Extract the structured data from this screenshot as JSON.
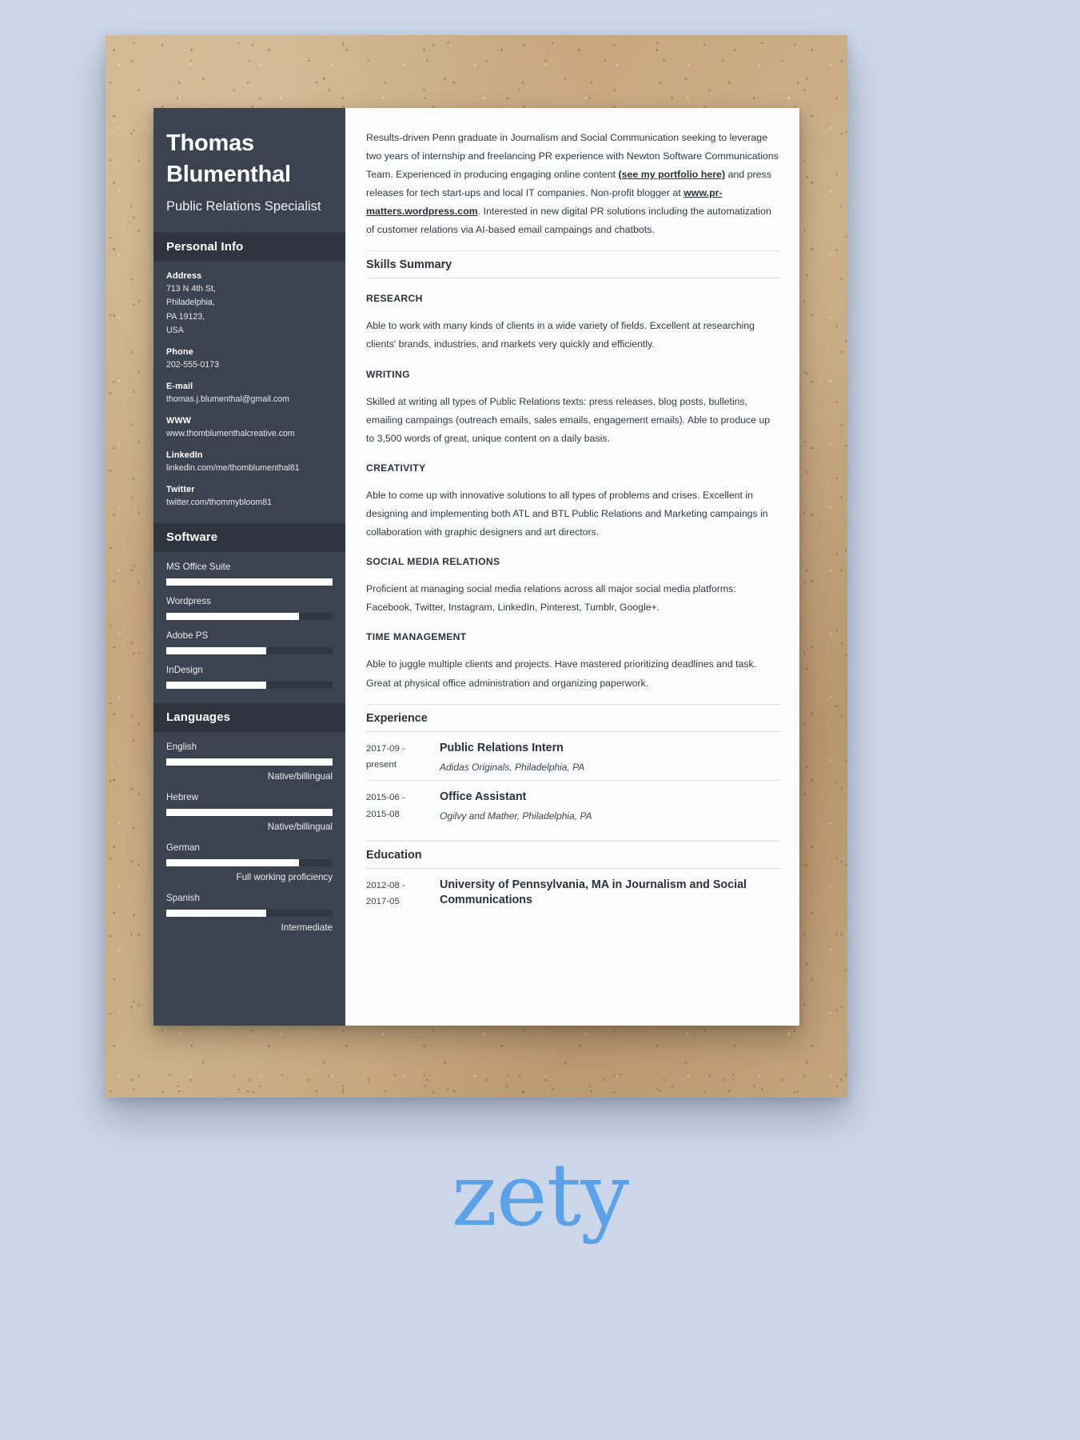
{
  "sidebar": {
    "name": "Thomas Blumenthal",
    "job_title": "Public Relations Specialist",
    "personal_info": {
      "heading": "Personal Info",
      "fields": [
        {
          "label": "Address",
          "value": "713 N 4th St,\nPhiladelphia,\nPA 19123,\nUSA"
        },
        {
          "label": "Phone",
          "value": "202-555-0173"
        },
        {
          "label": "E-mail",
          "value": "thomas.j.blumenthal@gmail.com"
        },
        {
          "label": "WWW",
          "value": "www.thomblumenthalcreative.com"
        },
        {
          "label": "LinkedIn",
          "value": "linkedin.com/me/thomblumenthal81"
        },
        {
          "label": "Twitter",
          "value": "twitter.com/thommybloom81"
        }
      ]
    },
    "software": {
      "heading": "Software",
      "items": [
        {
          "name": "MS Office Suite",
          "percent": 100,
          "level": ""
        },
        {
          "name": "Wordpress",
          "percent": 80,
          "level": ""
        },
        {
          "name": "Adobe PS",
          "percent": 60,
          "level": ""
        },
        {
          "name": "InDesign",
          "percent": 60,
          "level": ""
        }
      ]
    },
    "languages": {
      "heading": "Languages",
      "items": [
        {
          "name": "English",
          "percent": 100,
          "level": "Native/billingual"
        },
        {
          "name": "Hebrew",
          "percent": 100,
          "level": "Native/billingual"
        },
        {
          "name": "German",
          "percent": 80,
          "level": "Full working proficiency"
        },
        {
          "name": "Spanish",
          "percent": 60,
          "level": "Intermediate"
        }
      ]
    }
  },
  "main": {
    "summary": {
      "part1": "Results-driven Penn graduate in Journalism and Social Communication seeking to leverage two years of internship and freelancing PR experience with Newton Software Communications Team. Experienced in producing engaging online content ",
      "link1": "(see my portfolio here)",
      "part2": " and press releases for tech start-ups and local IT companies. Non-profit blogger at ",
      "link2": "www.pr-matters.wordpress.com",
      "part3": ". Interested in new digital PR solutions including the automatization of customer relations via AI-based email campaings and chatbots."
    },
    "skills_section_title": "Skills Summary",
    "skills": [
      {
        "heading": "RESEARCH",
        "text": "Able to work with many kinds of clients in a wide variety of fields. Excellent at researching clients' brands, industries, and markets very quickly and efficiently."
      },
      {
        "heading": "WRITING",
        "text": "Skilled at writing all types of Public Relations texts: press releases, blog posts, bulletins, emailing campaings (outreach emails, sales emails, engagement emails). Able to produce up to 3,500 words of great, unique content on a daily basis."
      },
      {
        "heading": "CREATIVITY",
        "text": "Able to come up with innovative solutions to all types of problems and crises. Excellent in designing and implementing both ATL and BTL Public Relations and Marketing campaings in collaboration with graphic designers and art directors."
      },
      {
        "heading": "SOCIAL MEDIA RELATIONS",
        "text": "Proficient at managing social media relations across all major social media platforms: Facebook, Twitter, Instagram, LinkedIn, Pinterest, Tumblr, Google+."
      },
      {
        "heading": "TIME MANAGEMENT",
        "text": "Able to juggle multiple clients and projects. Have mastered prioritizing deadlines and task. Great at physical office administration and organizing paperwork."
      }
    ],
    "experience_section_title": "Experience",
    "experience": [
      {
        "date": "2017-09 - present",
        "title": "Public Relations Intern",
        "subtitle": "Adidas Originals, Philadelphia, PA"
      },
      {
        "date": "2015-06 - 2015-08",
        "title": "Office Assistant",
        "subtitle": "Ogilvy and Mather, Philadelphia, PA"
      }
    ],
    "education_section_title": "Education",
    "education": [
      {
        "date": "2012-08 - 2017-05",
        "title": "University of Pennsylvania, MA in Journalism and Social Communications",
        "subtitle": ""
      }
    ]
  },
  "branding": {
    "logo_text": "zety"
  },
  "colors": {
    "sidebar_bg": "#3b4350",
    "sidebar_header_bg": "#2e353f",
    "sheet_bg": "#fcfcfc",
    "bar_fill": "#ffffff",
    "bar_track": "#2f3742",
    "logo_blue": "#5ba2e8",
    "page_bg": "#ccd8ea"
  }
}
